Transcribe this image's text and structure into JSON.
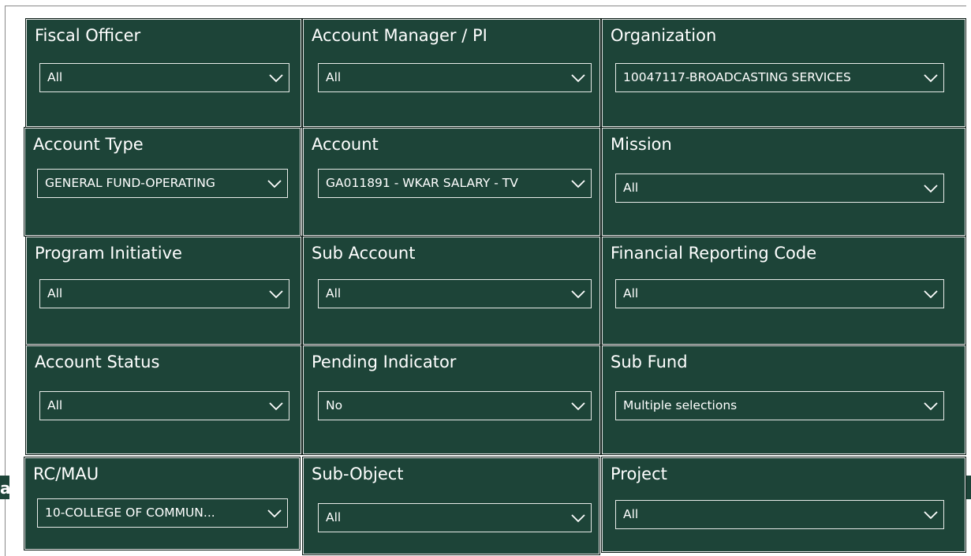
{
  "side_label": "ar",
  "slicers": [
    {
      "title": "Fiscal Officer",
      "value": "All"
    },
    {
      "title": "Account Manager / PI",
      "value": "All"
    },
    {
      "title": "Organization",
      "value": "10047117-BROADCASTING SERVICES"
    },
    {
      "title": "Account Type",
      "value": "GENERAL FUND-OPERATING"
    },
    {
      "title": "Account",
      "value": "GA011891 - WKAR SALARY - TV"
    },
    {
      "title": "Mission",
      "value": "All"
    },
    {
      "title": "Program Initiative",
      "value": "All"
    },
    {
      "title": "Sub Account",
      "value": "All"
    },
    {
      "title": "Financial Reporting Code",
      "value": "All"
    },
    {
      "title": "Account Status",
      "value": "All"
    },
    {
      "title": "Pending Indicator",
      "value": "No"
    },
    {
      "title": "Sub Fund",
      "value": "Multiple selections"
    },
    {
      "title": "RC/MAU",
      "value": "10-COLLEGE OF COMMUN..."
    },
    {
      "title": "Sub-Object",
      "value": "All"
    },
    {
      "title": "Project",
      "value": "All"
    }
  ],
  "icons": {
    "dropdown": "chevron-down-icon"
  },
  "colors": {
    "panel": "#1d4438",
    "text": "#ffffff",
    "border": "#e8ece9"
  }
}
